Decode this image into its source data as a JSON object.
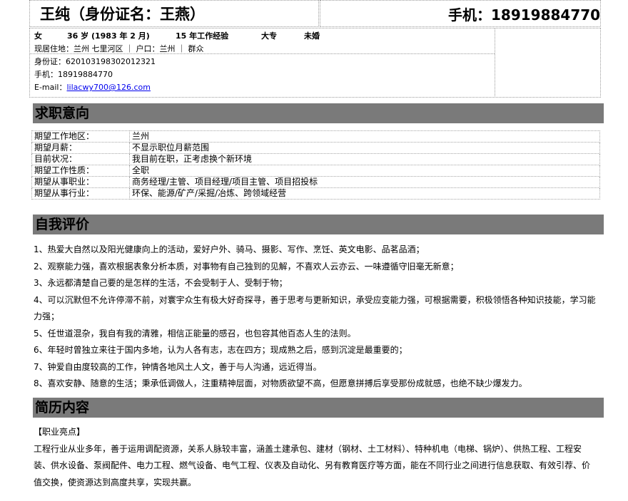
{
  "header": {
    "name_title": "王纯（身份证名：王燕）",
    "phone_title": "手机：18919884770",
    "meta": [
      "女",
      "36 岁 (1983 年 2 月)",
      "15 年工作经验",
      "大专",
      "未婚"
    ],
    "residence_label": "现居住地：",
    "residence_value": "兰州 七里河区 ｜ 户口：兰州 ｜ 群众",
    "id_label": "身份证：",
    "id_value": "620103198302012321",
    "mobile_label": "手机：",
    "mobile_value": "18919884770",
    "email_label": "E-mail：",
    "email_value": "lilacwy700@126.com"
  },
  "sections": {
    "intent_title": "求职意向",
    "self_title": "自我评价",
    "resume_title": "简历内容"
  },
  "intent_rows": [
    {
      "key": "期望工作地区：",
      "value": "兰州"
    },
    {
      "key": "期望月薪：",
      "value": "不显示职位月薪范围"
    },
    {
      "key": "目前状况：",
      "value": "我目前在职，正考虑换个新环境"
    },
    {
      "key": "期望工作性质：",
      "value": "全职"
    },
    {
      "key": "期望从事职业：",
      "value": "商务经理/主管、项目经理/项目主管、项目招投标"
    },
    {
      "key": "期望从事行业：",
      "value": "环保、能源/矿产/采掘/冶炼、跨领域经营"
    }
  ],
  "self_eval": [
    "1、热爱大自然以及阳光健康向上的活动，爱好户外、骑马、摄影、写作、烹饪、英文电影、品茗品酒；",
    "2、观察能力强，喜欢根据表象分析本质，对事物有自己独到的见解，不喜欢人云亦云、一味遵循守旧毫无新意；",
    "3、永远都清楚自己要的是怎样的生活，不会受制于人、受制于物；",
    "4、可以沉默但不允许停滞不前，对寰宇众生有极大好奇探寻，善于思考与更新知识，承受应变能力强，可根据需要，积极领悟各种知识技能，学习能力强；",
    "5、任世道混杂，我自有我的清雅，相信正能量的感召，也包容其他百态人生的法则。",
    "6、年轻时曾独立来往于国内多地，认为人各有志，志在四方；现成熟之后，感到沉淀是最重要的；",
    "7、钟爱自由度较高的工作，钟情各地风土人文，善于与人沟通，远近得当。",
    "8、喜欢安静、随意的生活；秉承低调做人，注重精神层面，对物质欲望不高，但愿意拼搏后享受那份成就感，也绝不缺少爆发力。"
  ],
  "resume": {
    "highlight_label": "【职业亮点】",
    "highlight_text": "工程行业从业多年，善于运用调配资源，关系人脉较丰富，涵盖土建承包、建材（钢材、土工材料）、特种机电（电梯、锅炉）、供热工程、工程安装、供水设备、泵阀配件、电力工程、燃气设备、电气工程、仪表及自动化、另有教育医疗等方面，能在不同行业之间进行信息获取、有效引荐、价值交换，使资源达到高度共享，实现共赢。"
  }
}
